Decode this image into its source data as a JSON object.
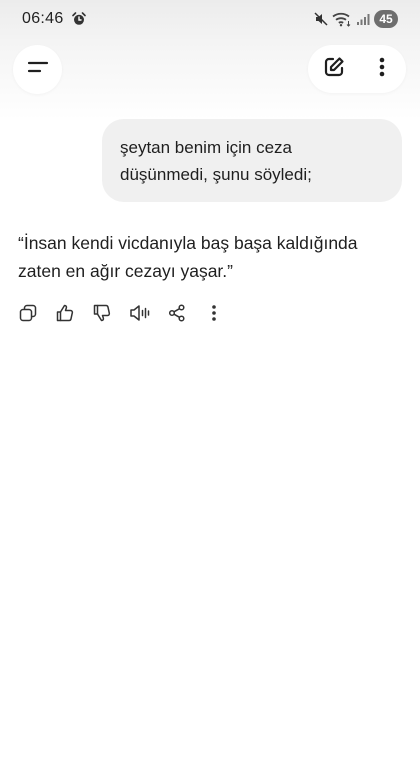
{
  "status_bar": {
    "time": "06:46",
    "battery_level": "45",
    "icons": [
      "alarm-icon",
      "mute-icon",
      "wifi-icon",
      "signal-icon",
      "battery-icon"
    ]
  },
  "header": {
    "icons": [
      "menu-icon",
      "edit-icon",
      "more-vertical-icon"
    ]
  },
  "conversation": {
    "user_message": {
      "line1": "şeytan benim için ceza",
      "line2": "düşünmedi, şunu söyledi;"
    },
    "response": {
      "line1": "“İnsan kendi vicdanıyla baş başa kaldığında",
      "line2": "zaten en ağır cezayı yaşar.”"
    },
    "response_actions": [
      "copy-icon",
      "thumbs-up-icon",
      "thumbs-down-icon",
      "read-aloud-icon",
      "share-icon",
      "more-vertical-icon"
    ]
  },
  "colors": {
    "background": "#ffffff",
    "user_bubble": "#f0f0f0",
    "text": "#1f1f1f",
    "battery_badge": "#6e6e6e"
  }
}
